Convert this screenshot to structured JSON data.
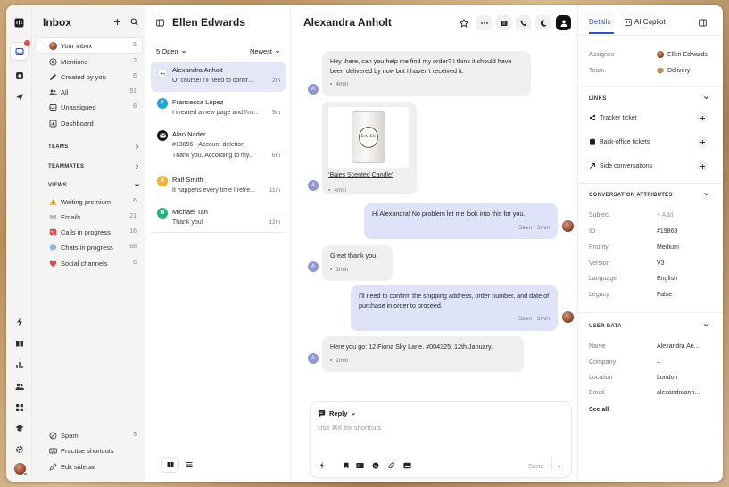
{
  "nav": {
    "title": "Inbox",
    "items": [
      {
        "label": "Your inbox",
        "count": "5"
      },
      {
        "label": "Mentions",
        "count": "2"
      },
      {
        "label": "Created by you",
        "count": "6"
      },
      {
        "label": "All",
        "count": "91"
      },
      {
        "label": "Unassigned",
        "count": "8"
      },
      {
        "label": "Dashboard",
        "count": ""
      }
    ],
    "sections": {
      "teams": "TEAMS",
      "teammates": "TEAMMATES",
      "views": "VIEWS"
    },
    "views": [
      {
        "label": "Waiting premium",
        "count": "6"
      },
      {
        "label": "Emails",
        "count": "21"
      },
      {
        "label": "Calls in progress",
        "count": "16"
      },
      {
        "label": "Chats in progress",
        "count": "68"
      },
      {
        "label": "Social channels",
        "count": "6"
      }
    ],
    "footer": [
      {
        "label": "Spam",
        "count": "3"
      },
      {
        "label": "Practise shortcuts",
        "count": ""
      },
      {
        "label": "Edit sidebar",
        "count": ""
      }
    ]
  },
  "list": {
    "owner": "Ellen Edwards",
    "filter": "5 Open",
    "sort": "Newest",
    "conversations": [
      {
        "name": "Alexandra Anholt",
        "preview": "Of course! I'll need to confir...",
        "time": "2m",
        "initial": "",
        "color": "#ffffff"
      },
      {
        "name": "Francesca Lopez",
        "preview": "I created a new page and I'm...",
        "time": "5m",
        "initial": "F",
        "color": "#1aa6d9"
      },
      {
        "name": "Alan Nader",
        "preview": "#13896 - Account deletion",
        "preview2": "Thank you. According to my...",
        "time": "6m",
        "initial": "",
        "color": "#111111"
      },
      {
        "name": "Ralf Smith",
        "preview": "It happens every time I refre...",
        "time": "11m",
        "initial": "R",
        "color": "#f2b233"
      },
      {
        "name": "Michael Tan",
        "preview": "Thank you!",
        "time": "12m",
        "initial": "M",
        "color": "#22b07d"
      }
    ]
  },
  "conversation": {
    "title": "Alexandra Anholt",
    "messages": [
      {
        "dir": "in",
        "text": "Hey there, can you help me find my order? I think it should have been delivered by now but I haven't received it.",
        "meta": "4min"
      },
      {
        "dir": "in",
        "image_caption": "Baies Scented Candle",
        "image_label": "BAIES",
        "meta": "4min"
      },
      {
        "dir": "out",
        "text": "Hi Alexandra! No problem let me look into this for you.",
        "meta": "Seen · 3min"
      },
      {
        "dir": "in",
        "text": "Great thank you.",
        "meta": "3min"
      },
      {
        "dir": "out",
        "text": "I'll need to confirm the shipping address, order number, and date of purchase in order to proceed.",
        "meta": "Seen · 3min"
      },
      {
        "dir": "in",
        "text": "Here you go: 12 Fiona Sky Lane. #004325. 12th January.",
        "meta": "2min"
      }
    ],
    "customer_initial": "A",
    "composer": {
      "mode": "Reply",
      "placeholder": "Use ⌘K for shortcuts",
      "send": "Send"
    }
  },
  "details": {
    "tabs": [
      "Details",
      "AI Copilot"
    ],
    "assignee_label": "Assignee",
    "assignee": "Ellen Edwards",
    "team_label": "Team",
    "team": "Delivery",
    "links_title": "LINKS",
    "links": [
      "Tracker ticket",
      "Back-office tickets",
      "Side conversations"
    ],
    "attributes_title": "CONVERSATION ATTRIBUTES",
    "attributes": [
      {
        "label": "Subject",
        "value": "+ Add",
        "muted": true
      },
      {
        "label": "ID",
        "value": "#19869"
      },
      {
        "label": "Priority",
        "value": "Medium"
      },
      {
        "label": "Version",
        "value": "V3"
      },
      {
        "label": "Language",
        "value": "English"
      },
      {
        "label": "Legacy",
        "value": "False"
      }
    ],
    "user_title": "USER DATA",
    "user": [
      {
        "label": "Name",
        "value": "Alexandra An..."
      },
      {
        "label": "Company",
        "value": "–"
      },
      {
        "label": "Location",
        "value": "London"
      },
      {
        "label": "Email",
        "value": "alexandraanh..."
      }
    ],
    "see_all": "See all"
  },
  "colors": {
    "accent": "#2d4fd8",
    "outgoing": "#dfe3f8",
    "incoming": "#efefef",
    "selected": "#e4e8f6"
  }
}
